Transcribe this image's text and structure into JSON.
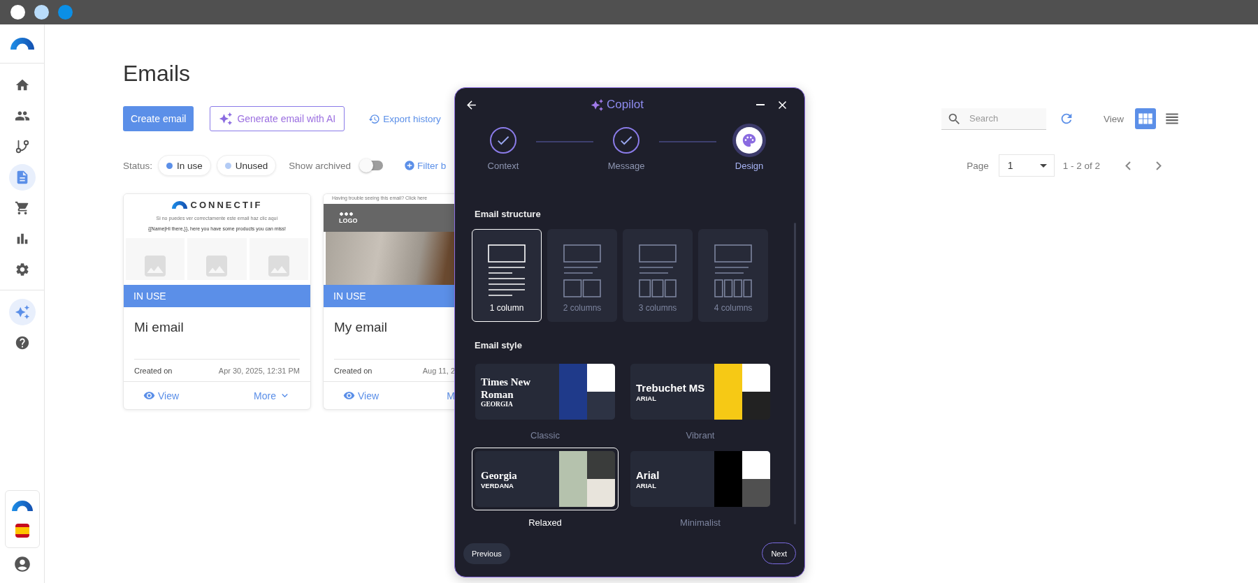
{
  "window": {
    "dots": [
      {
        "color": "#ffffff"
      },
      {
        "color": "#b9dcfa"
      },
      {
        "color": "#0b8fe6"
      }
    ]
  },
  "sidebar": {
    "items": [
      {
        "selected": false
      },
      {
        "selected": false
      },
      {
        "selected": false
      },
      {
        "selected": true
      },
      {
        "selected": false
      },
      {
        "selected": false
      },
      {
        "selected": false
      }
    ]
  },
  "page": {
    "title": "Emails",
    "actions": [
      {
        "kind": "primary",
        "label": "Create email"
      },
      {
        "kind": "ai",
        "label": "Generate email with AI"
      },
      {
        "kind": "link",
        "label": "Export history"
      }
    ],
    "search": {
      "placeholder": "Search"
    },
    "view": {
      "label": "View",
      "options": [
        {
          "selected": true
        },
        {
          "selected": false
        }
      ]
    },
    "status_label": "Status:",
    "status_filters": [
      {
        "label": "In use",
        "color": "#5b8fe8"
      },
      {
        "label": "Unused",
        "color": "#b3cbf5"
      }
    ],
    "show_archived": {
      "label": "Show archived",
      "on": false
    },
    "filter_link": "Filter b",
    "pagination": {
      "label": "Page",
      "value": "1",
      "range": "1 - 2 of 2"
    }
  },
  "emails": [
    {
      "preview": {
        "kind": "products",
        "brand": "CONNECTIF",
        "notice": "Si no puedes ver correctamente este email haz clic aquí",
        "greeting": "{{Name|Hi there,}}, here you have some products you can miss!"
      },
      "status": "IN USE",
      "name": "Mi email",
      "created_label": "Created on",
      "created": "Apr 30, 2025, 12:31 PM",
      "view": "View",
      "more": "More"
    },
    {
      "preview": {
        "kind": "photo",
        "notice": "Having trouble seeing this email? Click here",
        "logo": "LOGO"
      },
      "status": "IN USE",
      "name": "My email",
      "created_label": "Created on",
      "created": "Aug 11, 2",
      "view": "View",
      "more": "M"
    }
  ],
  "copilot": {
    "title": "Copilot",
    "steps": [
      {
        "label": "Context",
        "done": true,
        "selected": false
      },
      {
        "label": "Message",
        "done": true,
        "selected": false
      },
      {
        "label": "Design",
        "done": false,
        "selected": true
      }
    ],
    "structure_title": "Email structure",
    "structures": [
      {
        "label": "1 column",
        "selected": true
      },
      {
        "label": "2 columns",
        "selected": false
      },
      {
        "label": "3 columns",
        "selected": false
      },
      {
        "label": "4 columns",
        "selected": false
      }
    ],
    "style_title": "Email style",
    "styles": [
      {
        "heading": "Times New Roman",
        "sub": "GEORGIA",
        "swatches": [
          {
            "color": "#1f3a8a"
          },
          {
            "color": "#ffffff"
          },
          {
            "color": "#2d3344"
          }
        ],
        "label": "Classic",
        "selected": false
      },
      {
        "heading": "Trebuchet MS",
        "sub": "ARIAL",
        "swatches": [
          {
            "color": "#f6c915"
          },
          {
            "color": "#ffffff"
          },
          {
            "color": "#222222"
          }
        ],
        "label": "Vibrant",
        "selected": false
      },
      {
        "heading": "Georgia",
        "sub": "VERDANA",
        "swatches": [
          {
            "color": "#b5c2ad"
          },
          {
            "color": "#3a3c3b"
          },
          {
            "color": "#e8e4dc"
          }
        ],
        "label": "Relaxed",
        "selected": true
      },
      {
        "heading": "Arial",
        "sub": "ARIAL",
        "swatches": [
          {
            "color": "#000000"
          },
          {
            "color": "#ffffff"
          },
          {
            "color": "#505050"
          }
        ],
        "label": "Minimalist",
        "selected": false
      }
    ],
    "previous": "Previous",
    "next": "Next"
  }
}
